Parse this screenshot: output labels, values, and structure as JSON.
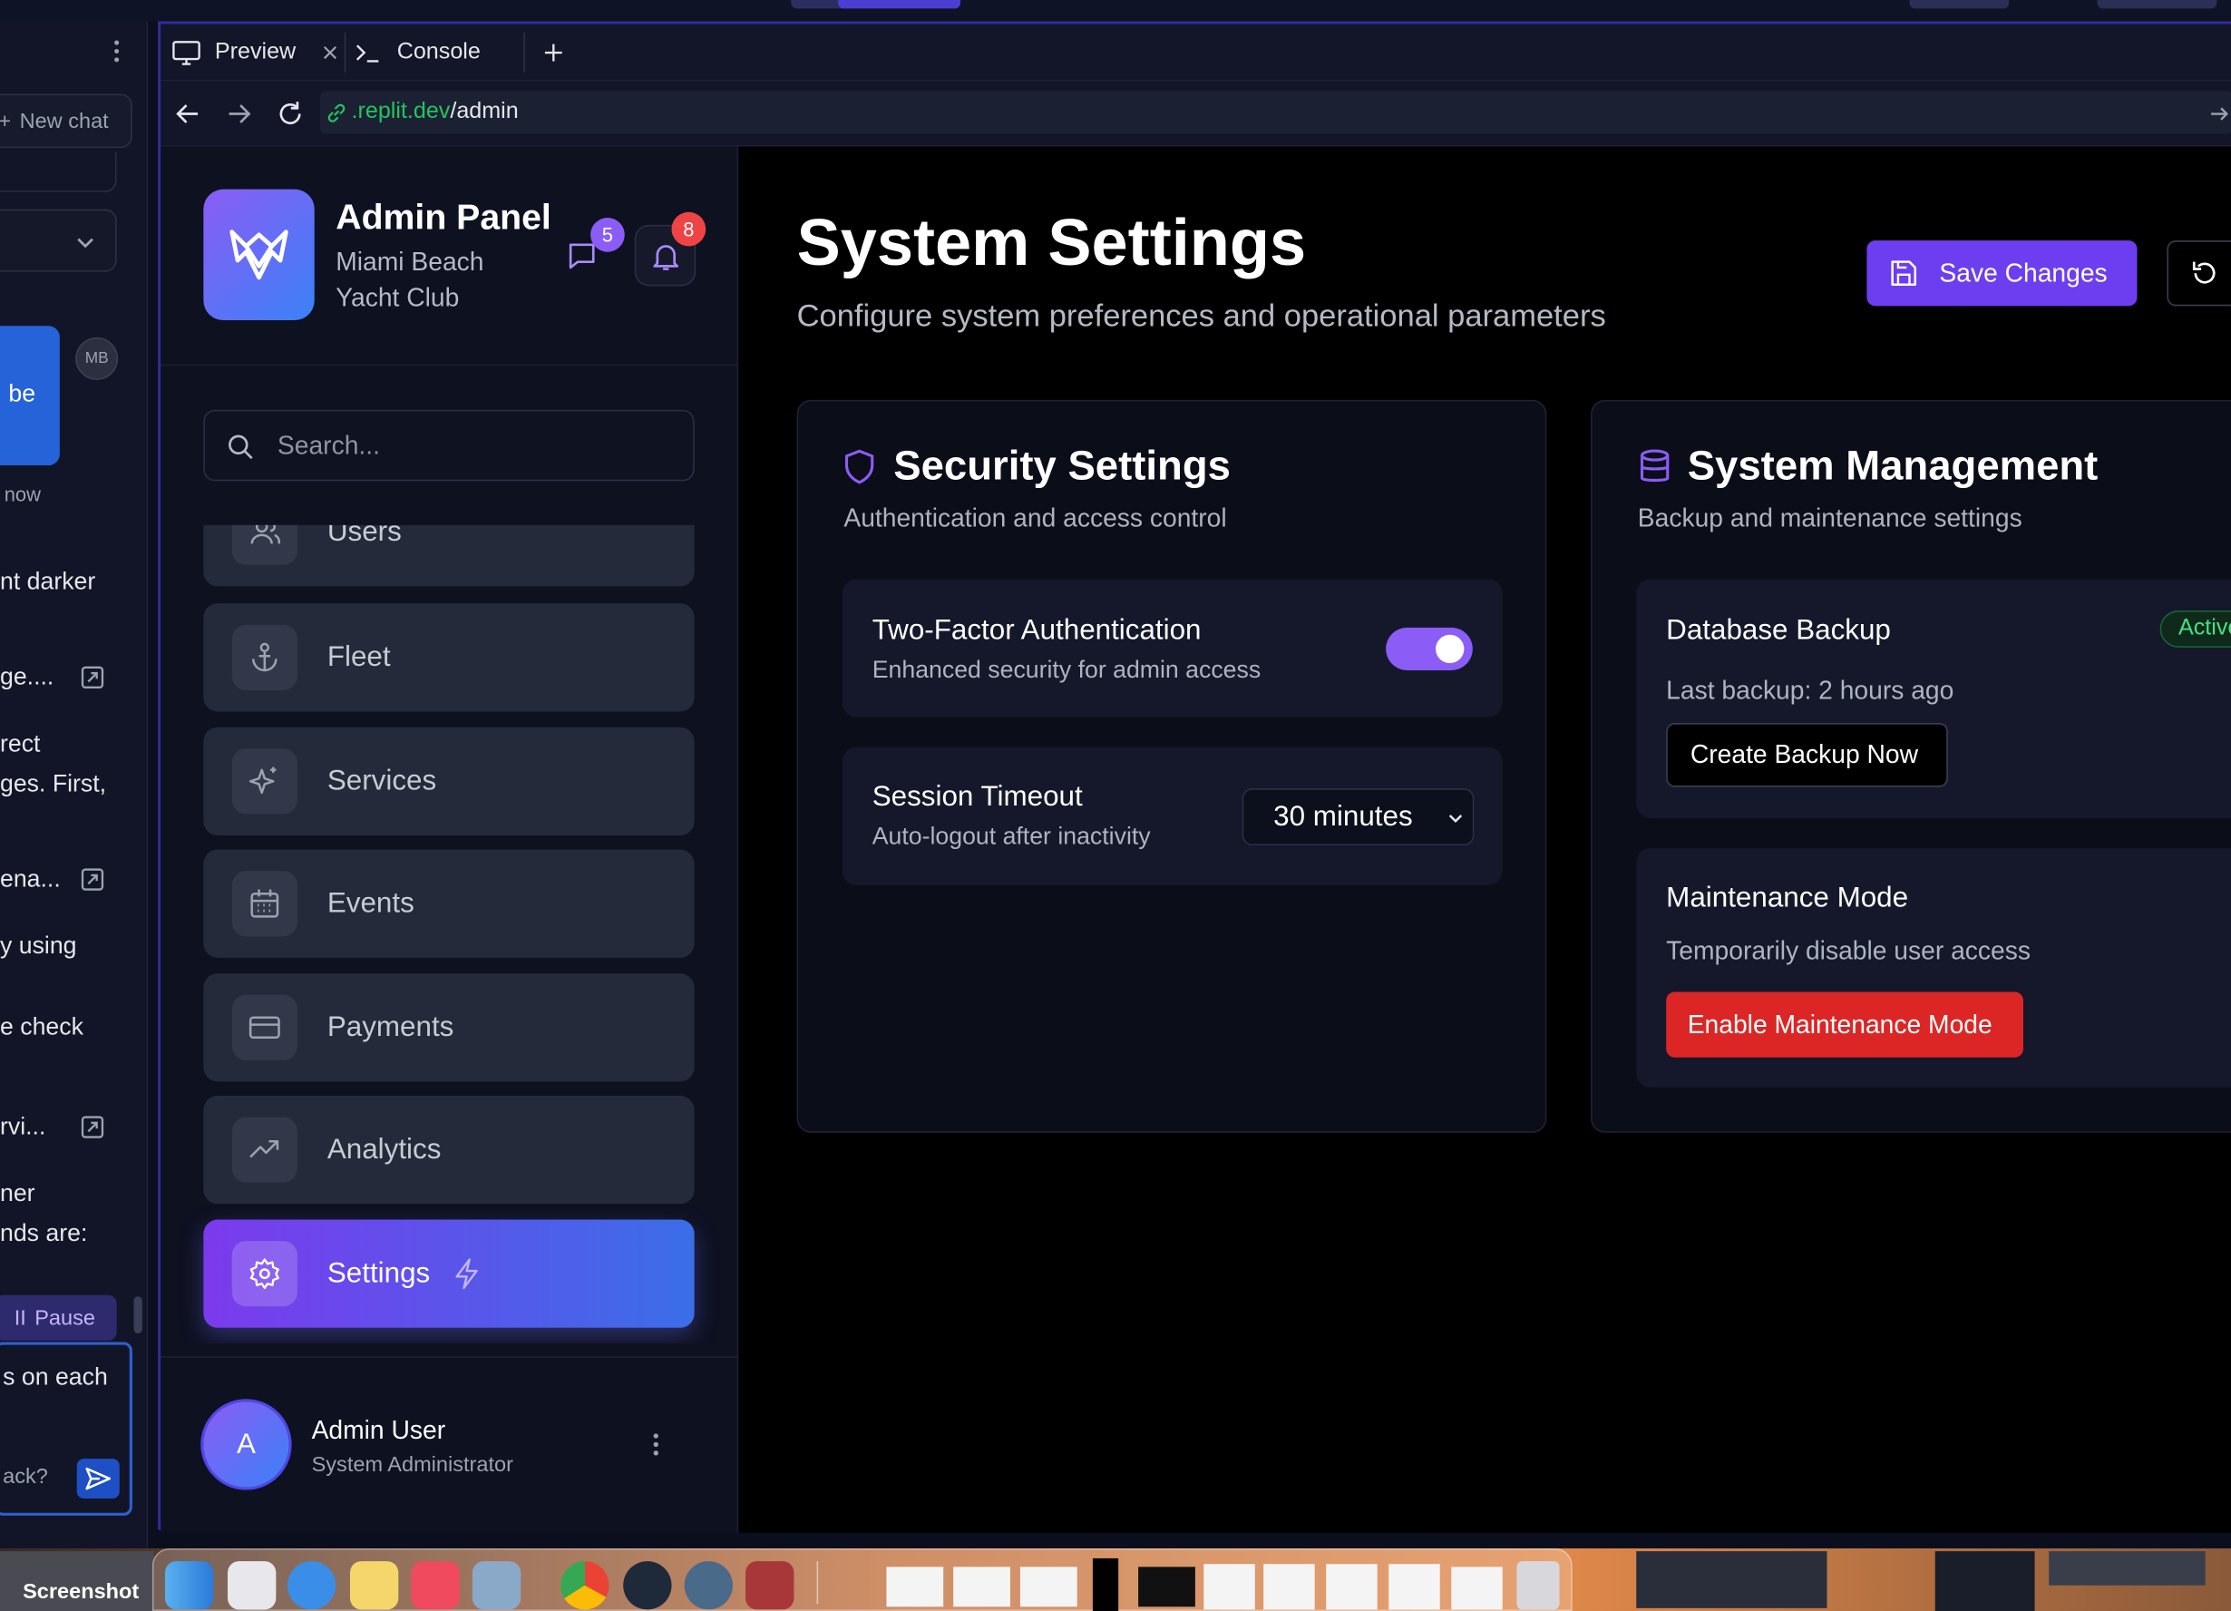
{
  "chat_panel": {
    "new_chat": "New chat",
    "avatar_initials": "MB",
    "snippets": [
      "be",
      "now",
      "nt darker",
      "ge....",
      "rect",
      "ges. First,",
      "ena...",
      "y using",
      "e check",
      "rvi...",
      "ner",
      "nds are:",
      "s on each",
      "ack?"
    ],
    "pause_label": "Pause"
  },
  "browser": {
    "tabs": [
      {
        "label": "Preview"
      },
      {
        "label": "Console"
      }
    ],
    "url_domain": ".replit.dev",
    "url_path": "/admin"
  },
  "sidebar": {
    "title": "Admin Panel",
    "subtitle_line1": "Miami Beach",
    "subtitle_line2": "Yacht Club",
    "messages_badge": "5",
    "notifications_badge": "8",
    "search_placeholder": "Search...",
    "nav": [
      {
        "label": "Users",
        "icon": "users-icon"
      },
      {
        "label": "Fleet",
        "icon": "anchor-icon"
      },
      {
        "label": "Services",
        "icon": "sparkles-icon"
      },
      {
        "label": "Events",
        "icon": "calendar-icon"
      },
      {
        "label": "Payments",
        "icon": "credit-card-icon"
      },
      {
        "label": "Analytics",
        "icon": "trending-up-icon"
      },
      {
        "label": "Settings",
        "icon": "gear-icon",
        "active": true
      }
    ],
    "user": {
      "initial": "A",
      "name": "Admin User",
      "role": "System Administrator"
    }
  },
  "main": {
    "title": "System Settings",
    "subtitle": "Configure system preferences and operational parameters",
    "save_label": "Save Changes",
    "security": {
      "title": "Security Settings",
      "subtitle": "Authentication and access control",
      "two_factor": {
        "title": "Two-Factor Authentication",
        "desc": "Enhanced security for admin access",
        "enabled": true
      },
      "session": {
        "title": "Session Timeout",
        "desc": "Auto-logout after inactivity",
        "value": "30 minutes"
      }
    },
    "system": {
      "title": "System Management",
      "subtitle": "Backup and maintenance settings",
      "backup": {
        "title": "Database Backup",
        "status": "Active",
        "last": "Last backup: 2 hours ago",
        "button": "Create Backup Now"
      },
      "maintenance": {
        "title": "Maintenance Mode",
        "desc": "Temporarily disable user access",
        "button": "Enable Maintenance Mode"
      }
    }
  },
  "dock": {
    "screenshot_label": "Screenshot"
  },
  "colors": {
    "accent": "#7c3aed",
    "accent_blue": "#3b6ee8",
    "danger": "#dc2626",
    "badge_red": "#ef4444",
    "badge_purple": "#8b5cf6",
    "link_green": "#22c55e"
  }
}
